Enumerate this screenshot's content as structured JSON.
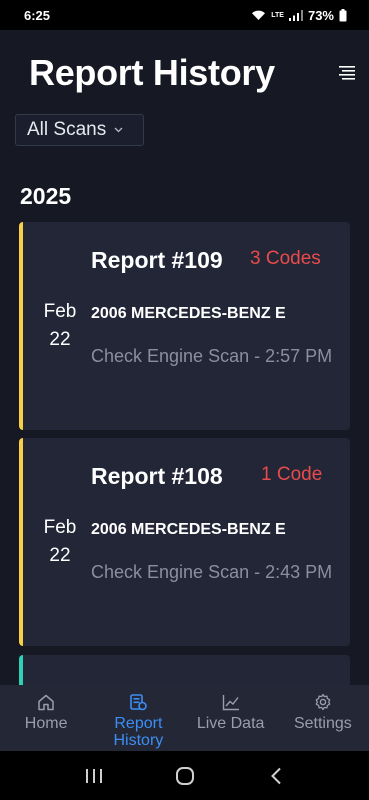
{
  "status_bar": {
    "time": "6:25",
    "network": "LTE",
    "battery": "73%"
  },
  "header": {
    "title": "Report History",
    "menu_icon": "hamburger-menu-icon"
  },
  "filter": {
    "selected": "All Scans"
  },
  "year_heading": "2025",
  "reports": [
    {
      "title": "Report #109",
      "codes": "3 Codes",
      "month": "Feb",
      "day": "22",
      "vehicle": "2006 MERCEDES-BENZ E",
      "description": "Check Engine Scan - 2:57 PM",
      "accent": "#f7d046",
      "codes_color": "#e84b4b"
    },
    {
      "title": "Report #108",
      "codes": "1 Code",
      "month": "Feb",
      "day": "22",
      "vehicle": "2006 MERCEDES-BENZ E",
      "description": "Check Engine Scan - 2:43 PM",
      "accent": "#f7d046",
      "codes_color": "#e84b4b"
    }
  ],
  "partial_card": {
    "accent": "#2fd1b6"
  },
  "bottom_nav": {
    "items": [
      {
        "label": "Home",
        "icon": "home-icon",
        "active": false
      },
      {
        "label": "Report History",
        "icon": "report-history-icon",
        "active": true
      },
      {
        "label": "Live Data",
        "icon": "chart-line-icon",
        "active": false
      },
      {
        "label": "Settings",
        "icon": "gear-icon",
        "active": false
      }
    ]
  },
  "colors": {
    "background": "#161924",
    "card": "#222637",
    "active_nav": "#3d8ef4",
    "error": "#e84b4b"
  }
}
